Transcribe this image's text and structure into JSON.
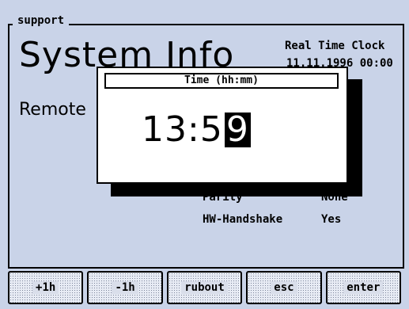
{
  "group": {
    "legend": "support"
  },
  "page": {
    "title": "System Info",
    "subtitle": "Remote"
  },
  "rtc": {
    "label": "Real Time Clock",
    "value": "11.11.1996 00:00"
  },
  "settings": [
    {
      "key": "Parity",
      "value": "None"
    },
    {
      "key": "HW-Handshake",
      "value": "Yes"
    }
  ],
  "dialog": {
    "title": "Time (hh:mm)",
    "value_text": "13:5",
    "cursor_char": "9"
  },
  "softkeys": [
    {
      "label": "+1h"
    },
    {
      "label": "-1h"
    },
    {
      "label": "rubout"
    },
    {
      "label": "esc"
    },
    {
      "label": "enter"
    }
  ]
}
